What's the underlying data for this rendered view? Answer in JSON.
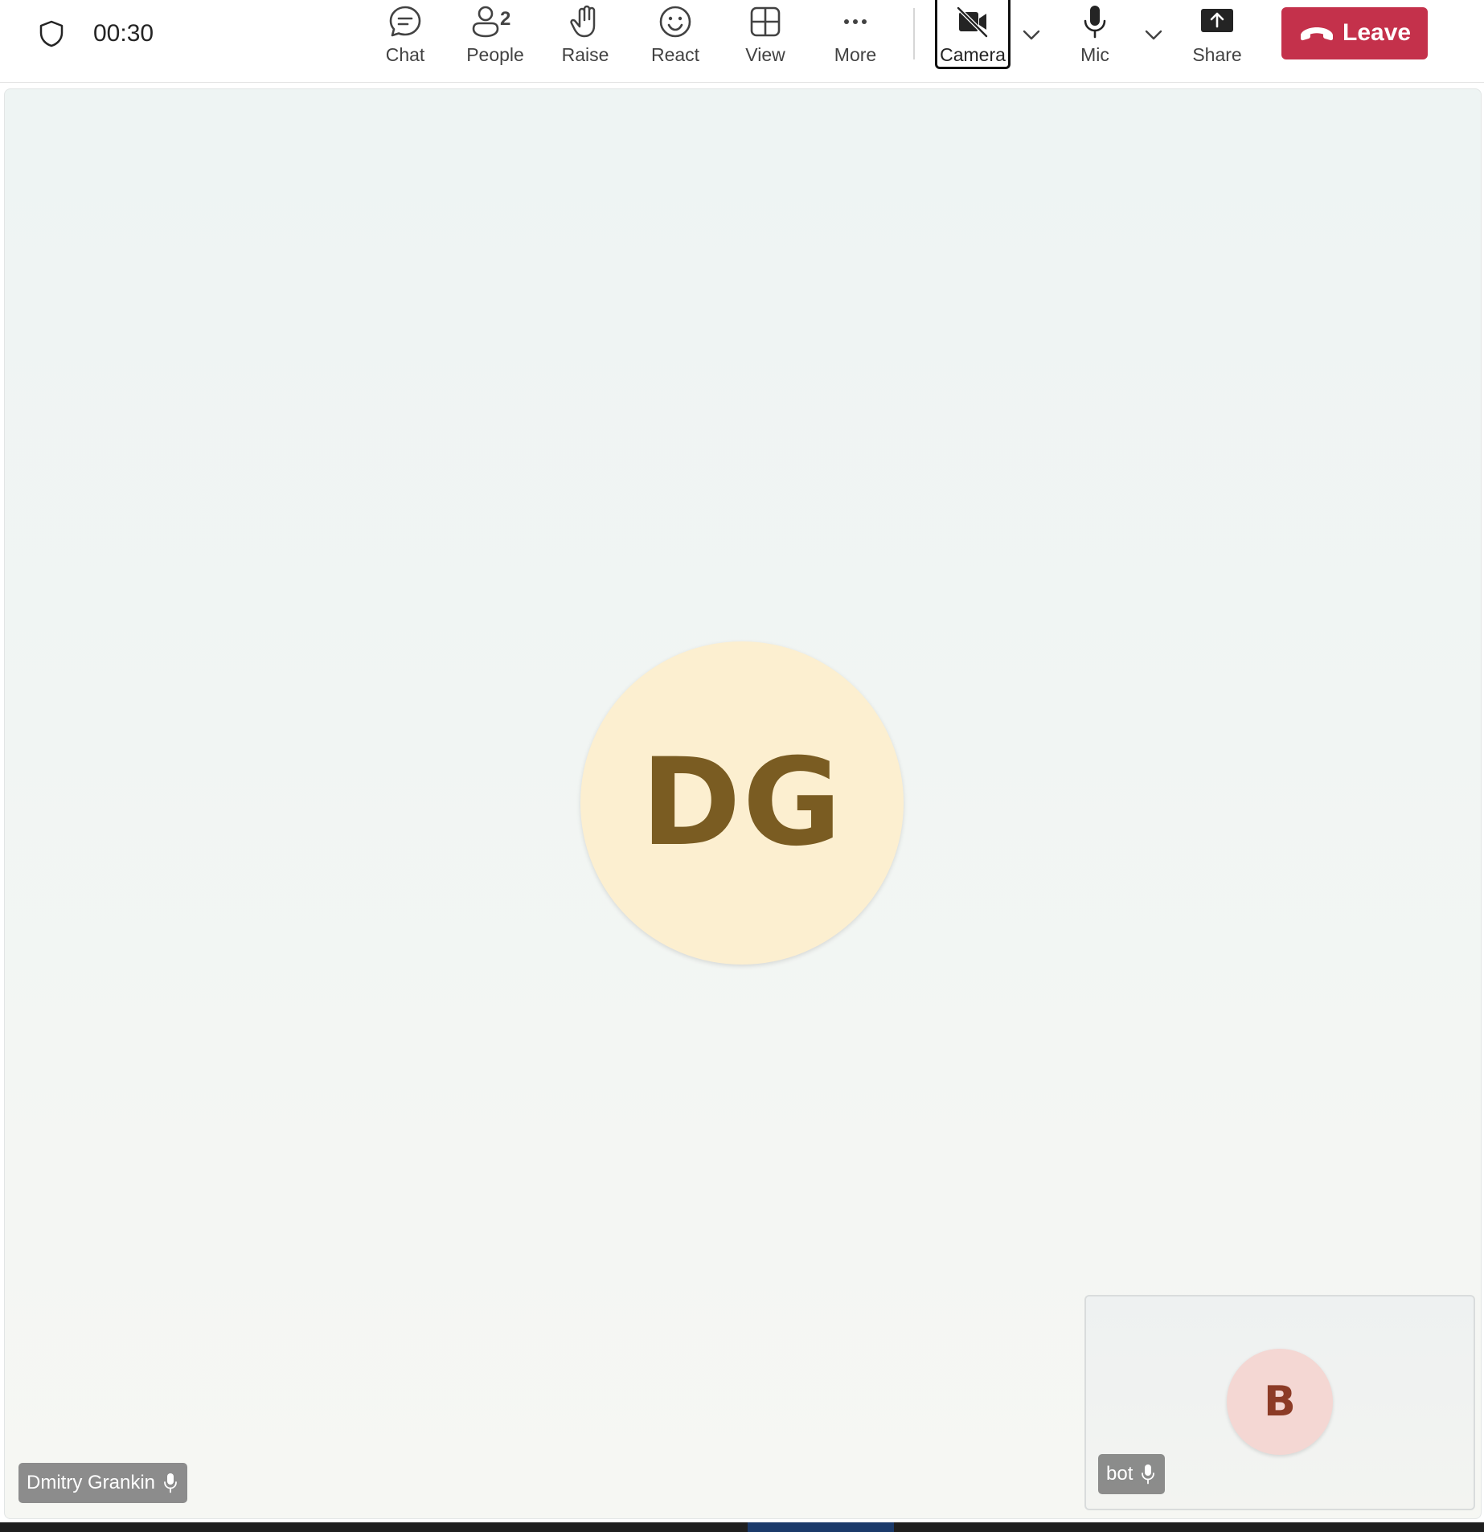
{
  "meeting": {
    "timer": "00:30"
  },
  "toolbar": {
    "chat_label": "Chat",
    "people_label": "People",
    "people_count": "2",
    "raise_label": "Raise",
    "react_label": "React",
    "view_label": "View",
    "more_label": "More",
    "camera_label": "Camera",
    "mic_label": "Mic",
    "share_label": "Share",
    "leave_label": "Leave"
  },
  "stage": {
    "main_participant": {
      "initials": "DG",
      "name": "Dmitry Grankin"
    },
    "self_participant": {
      "initials": "B",
      "name": "bot"
    }
  },
  "colors": {
    "leave": "#c4314b",
    "main_avatar_bg": "#fcefd0",
    "main_avatar_text": "#7a5c22",
    "self_avatar_bg": "#f4d7d3",
    "self_avatar_text": "#8c3b26"
  },
  "icons": [
    "shield-icon",
    "chat-icon",
    "people-icon",
    "raise-hand-icon",
    "react-icon",
    "view-icon",
    "more-icon",
    "camera-off-icon",
    "chevron-down-icon",
    "mic-icon",
    "share-icon",
    "hang-up-icon"
  ]
}
